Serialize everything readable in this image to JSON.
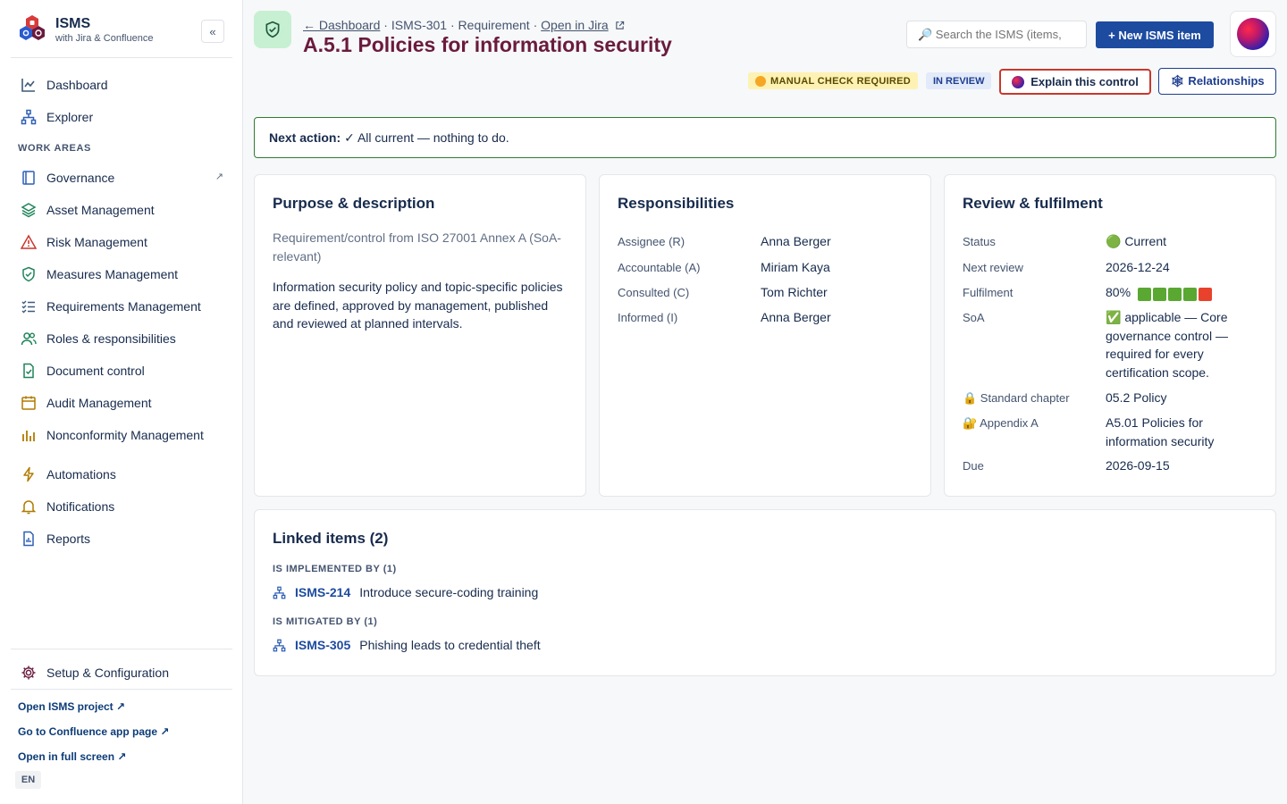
{
  "brand": {
    "title": "ISMS",
    "subtitle": "with Jira & Confluence",
    "collapse_label": "«"
  },
  "sidebar": {
    "top_items": [
      {
        "label": "Dashboard",
        "icon": "line-chart-icon"
      },
      {
        "label": "Explorer",
        "icon": "hierarchy-icon"
      }
    ],
    "section_label": "WORK AREAS",
    "work_items": [
      {
        "label": "Governance",
        "icon": "book-icon",
        "ext": "↗"
      },
      {
        "label": "Asset Management",
        "icon": "layers-icon"
      },
      {
        "label": "Risk Management",
        "icon": "warning-icon"
      },
      {
        "label": "Measures Management",
        "icon": "shield-check-icon"
      },
      {
        "label": "Requirements Management",
        "icon": "checklist-icon"
      },
      {
        "label": "Roles & responsibilities",
        "icon": "people-icon"
      },
      {
        "label": "Document control",
        "icon": "document-check-icon"
      },
      {
        "label": "Audit Management",
        "icon": "calendar-icon"
      },
      {
        "label": "Nonconformity Management",
        "icon": "bar-chart-icon"
      }
    ],
    "tool_items": [
      {
        "label": "Automations",
        "icon": "lightning-icon"
      },
      {
        "label": "Notifications",
        "icon": "bell-icon"
      },
      {
        "label": "Reports",
        "icon": "report-icon"
      }
    ],
    "setup_label": "Setup & Configuration",
    "links": [
      "Open ISMS project ↗",
      "Go to Confluence app page ↗",
      "Open in full screen ↗"
    ],
    "language": "EN"
  },
  "header": {
    "breadcrumb": {
      "back": "← Dashboard",
      "sep": " · ",
      "key": "ISMS-301",
      "type": "Requirement",
      "jira": "Open in Jira"
    },
    "title": "A.5.1 Policies for information security",
    "search_placeholder": "🔎 Search the ISMS (items,",
    "new_button": "+ New ISMS item",
    "badges": {
      "manual": "MANUAL CHECK REQUIRED",
      "review": "IN REVIEW"
    },
    "explain_button": "Explain this control",
    "relationships_button": "🕸 Relationships"
  },
  "next_action": {
    "label": "Next action:",
    "text": "✓ All current — nothing to do."
  },
  "purpose": {
    "title": "Purpose & description",
    "subtitle": "Requirement/control from ISO 27001 Annex A (SoA-relevant)",
    "description": "Information security policy and topic-specific policies are defined, approved by management, published and reviewed at planned intervals."
  },
  "responsibilities": {
    "title": "Responsibilities",
    "rows": [
      {
        "label": "Assignee (R)",
        "value": "Anna Berger"
      },
      {
        "label": "Accountable (A)",
        "value": "Miriam Kaya"
      },
      {
        "label": "Consulted (C)",
        "value": "Tom Richter"
      },
      {
        "label": "Informed (I)",
        "value": "Anna Berger"
      }
    ]
  },
  "review": {
    "title": "Review & fulfilment",
    "status_label": "Status",
    "status_value": "🟢 Current",
    "next_review_label": "Next review",
    "next_review_value": "2026-12-24",
    "fulfilment_label": "Fulfilment",
    "fulfilment_value": "80%",
    "fulfilment_fraction": 0.8,
    "fulfilment_colors": {
      "filled": "#5aa832",
      "empty": "#e8412c"
    },
    "soa_label": "SoA",
    "soa_value": "✅ applicable — Core governance control — required for every certification scope.",
    "chapter_label": "🔒 Standard chapter",
    "chapter_value": "05.2 Policy",
    "appendix_label": "🔐 Appendix A",
    "appendix_value": "A5.01 Policies for information security",
    "due_label": "Due",
    "due_value": "2026-09-15"
  },
  "linked": {
    "title": "Linked items (2)",
    "groups": [
      {
        "label": "IS IMPLEMENTED BY (1)",
        "key": "ISMS-214",
        "text": "Introduce secure-coding training"
      },
      {
        "label": "IS MITIGATED BY (1)",
        "key": "ISMS-305",
        "text": "Phishing leads to credential theft"
      }
    ]
  },
  "colors": {
    "accent": "#1d4ba0",
    "title": "#6a1b3d",
    "success": "#2e7d32",
    "icon_green": "#1f845a"
  }
}
